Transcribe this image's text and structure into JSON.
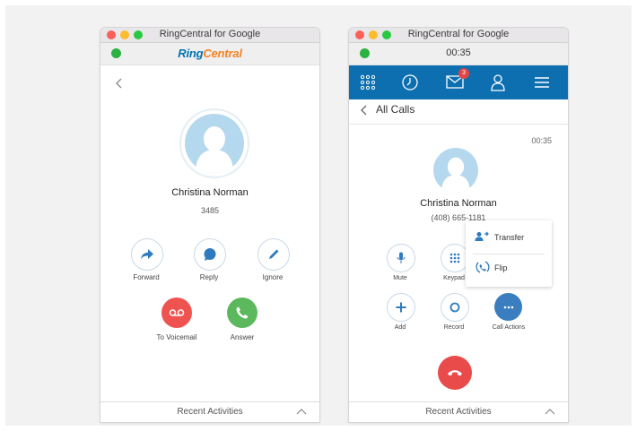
{
  "incoming_window": {
    "title": "RingCentral for Google",
    "brand_part1": "Ring",
    "brand_part2": "Central",
    "contact_name": "Christina Norman",
    "contact_number": "3485",
    "actions": [
      {
        "label": "Forward",
        "icon": "forward-arrow-icon"
      },
      {
        "label": "Reply",
        "icon": "chat-bubble-icon"
      },
      {
        "label": "Ignore",
        "icon": "pencil-icon"
      }
    ],
    "voicemail_label": "To Voicemail",
    "answer_label": "Answer",
    "recent_activities": "Recent Activities"
  },
  "active_window": {
    "title": "RingCentral for Google",
    "call_timer": "00:35",
    "nav": [
      {
        "icon": "dialpad-icon"
      },
      {
        "icon": "clock-icon"
      },
      {
        "icon": "envelope-icon",
        "badge": "3"
      },
      {
        "icon": "person-icon"
      },
      {
        "icon": "menu-icon"
      }
    ],
    "back_label": "All Calls",
    "elapsed": "00:35",
    "contact_name": "Christina Norman",
    "contact_number": "(408) 665-1181",
    "controls": [
      {
        "label": "Mute",
        "icon": "microphone-icon"
      },
      {
        "label": "Keypad",
        "icon": "keypad-icon"
      },
      {
        "label": "Add",
        "icon": "plus-icon"
      },
      {
        "label": "Record",
        "icon": "record-icon"
      },
      {
        "label": "Call Actions",
        "icon": "more-icon"
      }
    ],
    "call_actions_menu": [
      {
        "label": "Transfer",
        "icon": "transfer-icon"
      },
      {
        "label": "Flip",
        "icon": "flip-icon"
      }
    ],
    "recent_activities": "Recent Activities"
  },
  "colors": {
    "brand_blue": "#0073ae",
    "brand_orange": "#f58220",
    "nav_blue": "#0d6fb0",
    "voicemail_red": "#ef5350",
    "answer_green": "#5cb85c",
    "end_call_red": "#e94a4a",
    "action_blue": "#3a7ec0"
  }
}
